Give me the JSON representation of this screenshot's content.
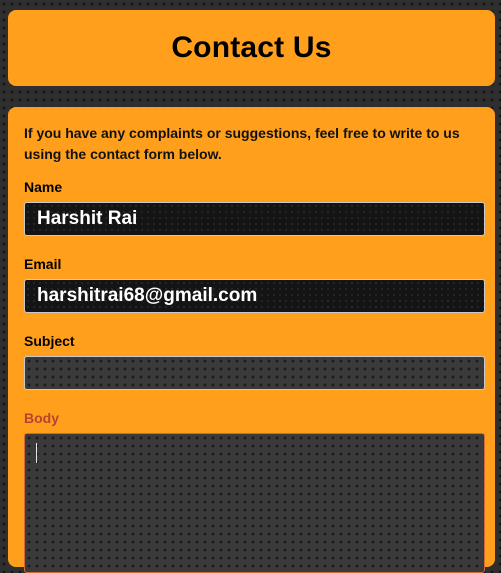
{
  "header": {
    "title": "Contact Us"
  },
  "form": {
    "intro": "If you have any complaints or suggestions, feel free to write to us using the contact form below.",
    "name": {
      "label": "Name",
      "value": "Harshit Rai"
    },
    "email": {
      "label": "Email",
      "value": "harshitrai68@gmail.com"
    },
    "subject": {
      "label": "Subject",
      "value": ""
    },
    "body": {
      "label": "Body",
      "value": ""
    }
  },
  "colors": {
    "accent": "#ff9f1c",
    "focused_label": "#b5462e",
    "background": "#2f2f2f"
  }
}
